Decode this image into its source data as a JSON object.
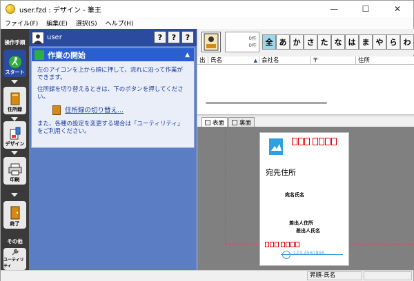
{
  "window": {
    "title": "user.fzd : デザイン - 筆王",
    "minimize_glyph": "—",
    "maximize_glyph": "☐",
    "close_glyph": "✕"
  },
  "menu": [
    {
      "label": "ファイル(F)"
    },
    {
      "label": "編集(E)"
    },
    {
      "label": "選択(S)"
    },
    {
      "label": "ヘルプ(H)"
    }
  ],
  "left_toolbar": {
    "section1": "操作手順",
    "buttons": [
      {
        "label": "スタート",
        "icon": "runner-icon",
        "active": true
      },
      {
        "label": "住所録",
        "icon": "address-book-icon",
        "active": false
      },
      {
        "label": "デザイン",
        "icon": "design-icon",
        "active": false
      },
      {
        "label": "印刷",
        "icon": "printer-icon",
        "active": false
      },
      {
        "label": "終了",
        "icon": "exit-door-icon",
        "active": false
      }
    ],
    "section2": "その他",
    "utility_label": "ユーティリティ"
  },
  "side_panel": {
    "user_name": "user",
    "help_buttons": [
      "?",
      "?",
      "?"
    ],
    "card_title": "作業の開始",
    "para1": "左のアイコンを上から順に押して、流れに沿って作業ができます。",
    "para2": "住所録を切り替えるときは、下のボタンを押してください。",
    "switch_link": "住所録の切り替え...",
    "para3": "また、各種の設定を変更する場合は「ユーティリティ」をご利用ください。"
  },
  "address_list": {
    "count_line1": "0件",
    "count_line2": "0件",
    "kana_tabs": [
      "全",
      "あ",
      "か",
      "さ",
      "た",
      "な",
      "は",
      "ま",
      "や",
      "ら",
      "わ"
    ],
    "selected_kana": "全",
    "columns": [
      {
        "label": "出",
        "width": 16
      },
      {
        "label": "氏名",
        "width": 74
      },
      {
        "label": "会社名",
        "width": 74
      },
      {
        "label": "〒",
        "width": 66
      },
      {
        "label": "住所",
        "width": 84
      }
    ]
  },
  "view_tabs": [
    {
      "label": "表面"
    },
    {
      "label": "裏面"
    }
  ],
  "postcard": {
    "recipient_address": "宛先住所",
    "recipient_name": "宛名氏名",
    "sender_address": "差出人住所",
    "sender_name": "差出人氏名",
    "barcode_text": "123-4567890"
  },
  "status": {
    "sort": "昇順-氏名"
  }
}
